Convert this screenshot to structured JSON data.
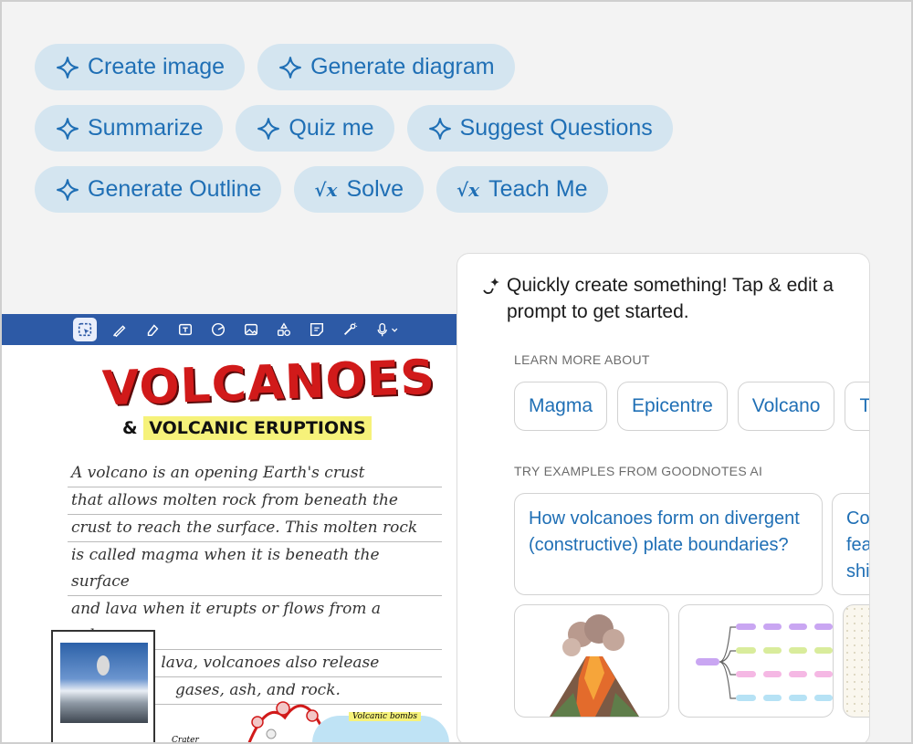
{
  "chips": {
    "row1": [
      {
        "label": "Create image",
        "icon": "sparkle-icon"
      },
      {
        "label": "Generate diagram",
        "icon": "sparkle-icon"
      }
    ],
    "row2": [
      {
        "label": "Summarize",
        "icon": "sparkle-icon"
      },
      {
        "label": "Quiz me",
        "icon": "sparkle-icon"
      },
      {
        "label": "Suggest Questions",
        "icon": "sparkle-icon"
      }
    ],
    "row3": [
      {
        "label": "Generate Outline",
        "icon": "sparkle-icon"
      },
      {
        "label": "Solve",
        "icon": "sqrt-x-icon",
        "glyph": "√x"
      },
      {
        "label": "Teach Me",
        "icon": "sqrt-x-icon",
        "glyph": "√x"
      }
    ]
  },
  "notes": {
    "title": "VOLCANOES",
    "subtitle_amp": "&",
    "subtitle": "VOLCANIC ERUPTIONS",
    "lines": [
      "A volcano is an opening Earth's crust",
      "that allows molten rock from beneath the",
      "crust to reach the surface. This molten rock",
      "is called magma when it is beneath the surface",
      "and lava when it erupts or flows from a volcano",
      "Along with lava, volcanoes also release",
      "gases, ash, and rock."
    ],
    "label_bombs": "Volcanic bombs",
    "label_crater": "Crater"
  },
  "panel": {
    "intro": "Quickly create something! Tap & edit a prompt to get started.",
    "learn_label": "LEARN MORE ABOUT",
    "topics": [
      "Magma",
      "Epicentre",
      "Volcano",
      "T"
    ],
    "examples_label": "TRY EXAMPLES FROM GOODNOTES AI",
    "examples": [
      "How volcanoes form on divergent (constructive) plate boundaries?",
      "Co fea shi"
    ]
  },
  "colors": {
    "chip_bg": "#d4e5f0",
    "chip_text": "#1f6fb5",
    "toolbar": "#2d5aa6",
    "title_red": "#d11a1a"
  }
}
